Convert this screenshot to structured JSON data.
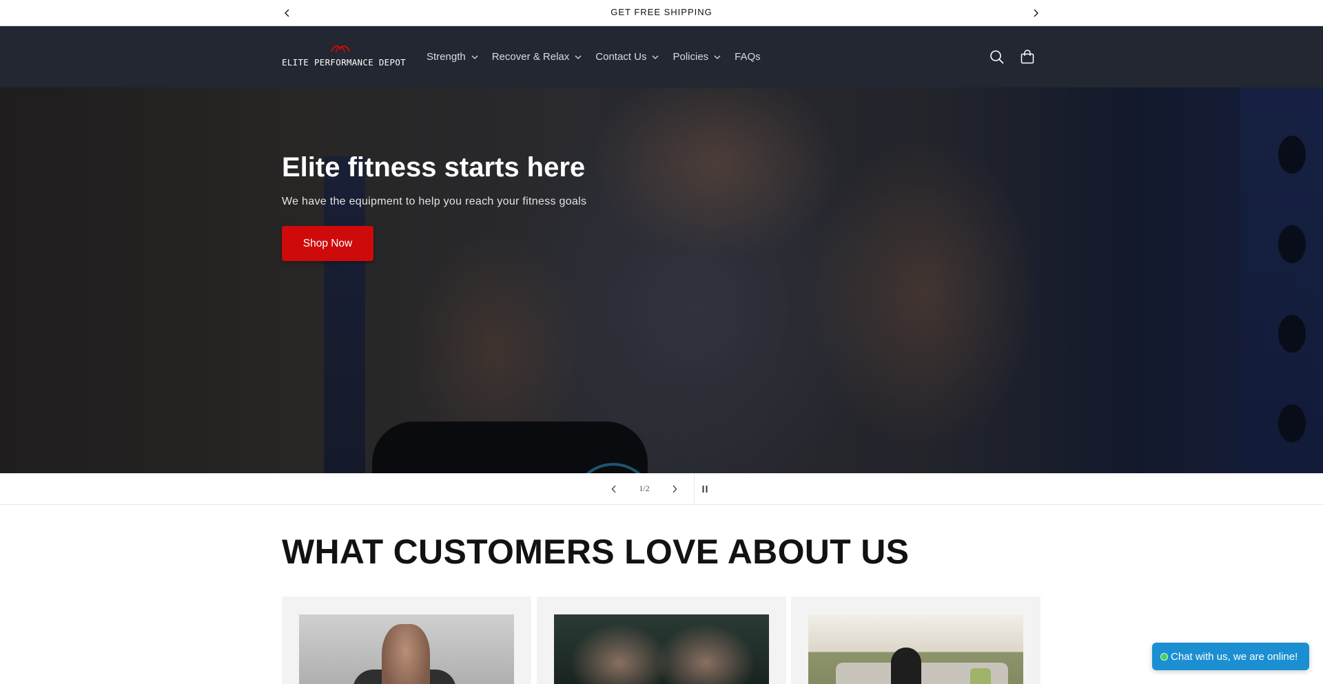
{
  "announcement": {
    "message": "GET FREE SHIPPING",
    "prev_icon": "chevron-left-icon",
    "next_icon": "chevron-right-icon"
  },
  "header": {
    "logo_text": "ELITE PERFORMANCE DEPOT",
    "nav": [
      {
        "label": "Strength",
        "has_dropdown": true
      },
      {
        "label": "Recover & Relax",
        "has_dropdown": true
      },
      {
        "label": "Contact Us",
        "has_dropdown": true
      },
      {
        "label": "Policies",
        "has_dropdown": true
      },
      {
        "label": "FAQs",
        "has_dropdown": false
      }
    ],
    "icons": [
      "search-icon",
      "cart-icon"
    ]
  },
  "hero": {
    "title": "Elite fitness starts here",
    "subtitle": "We have the equipment to help you reach your fitness goals",
    "cta_label": "Shop Now"
  },
  "slider": {
    "counter": "1/2"
  },
  "testimonials": {
    "title": "WHAT CUSTOMERS LOVE ABOUT US"
  },
  "chat": {
    "label": "Chat with us, we are online!"
  },
  "colors": {
    "header_bg": "#222731",
    "accent_red": "#cf0a0a",
    "chat_blue": "#1b8fd1",
    "online_green": "#43d35a"
  }
}
